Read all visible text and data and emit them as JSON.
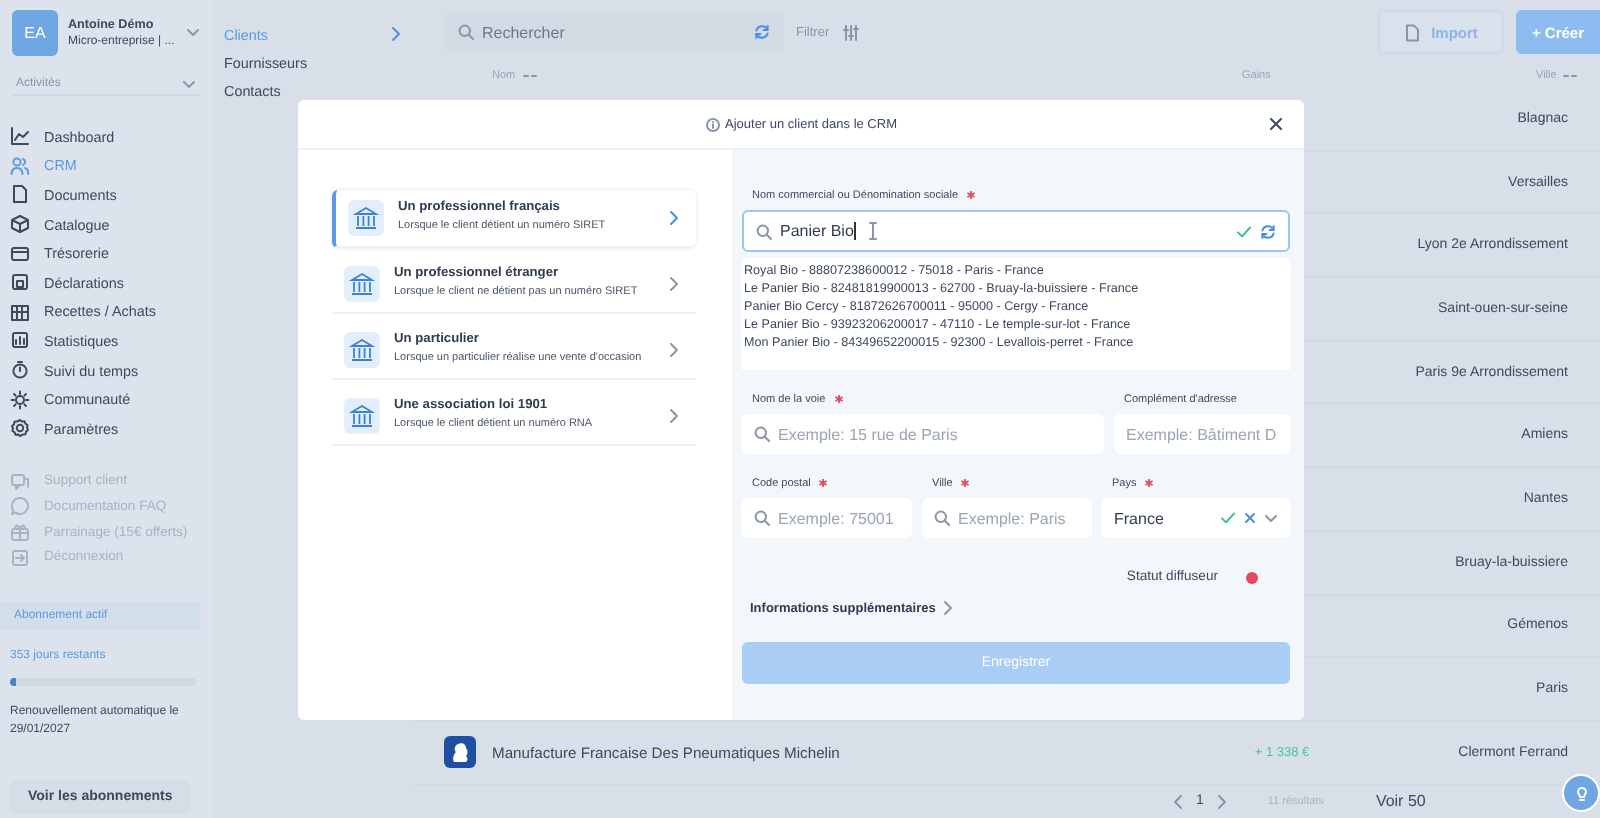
{
  "account": {
    "initials": "EA",
    "name": "Antoine Démo",
    "company": "Micro-entreprise | ..."
  },
  "activity_select": {
    "placeholder": "Activités"
  },
  "nav_items": [
    {
      "label": "Dashboard",
      "selected": false
    },
    {
      "label": "CRM",
      "selected": true
    },
    {
      "label": "Documents",
      "selected": false
    },
    {
      "label": "Catalogue",
      "selected": false
    },
    {
      "label": "Trésorerie",
      "selected": false
    },
    {
      "label": "Déclarations",
      "selected": false
    },
    {
      "label": "Recettes / Achats",
      "selected": false
    },
    {
      "label": "Statistiques",
      "selected": false
    },
    {
      "label": "Suivi du temps",
      "selected": false
    },
    {
      "label": "Communauté",
      "selected": false
    },
    {
      "label": "Paramètres",
      "selected": false
    }
  ],
  "help_items": [
    {
      "label": "Support client"
    },
    {
      "label": "Documentation FAQ"
    },
    {
      "label": "Parrainage (15€ offerts)"
    },
    {
      "label": "Déconnexion"
    }
  ],
  "subscription": {
    "badge": "Abonnement actif",
    "remaining": "353 jours restants",
    "level": 0.03,
    "renewal": "Renouvellement automatique le 29/01/2027",
    "button": "Voir les abonnements"
  },
  "subnav": [
    {
      "label": "Clients",
      "selected": true
    },
    {
      "label": "Fournisseurs",
      "selected": false
    },
    {
      "label": "Contacts",
      "selected": false
    }
  ],
  "toolbar": {
    "search_placeholder": "Rechercher",
    "filter": "Filtrer",
    "import": "Import",
    "create": "+ Créer"
  },
  "table": {
    "columns": [
      "Nom",
      "Gains",
      "Ville"
    ],
    "rows": [
      {
        "city": "Blagnac"
      },
      {
        "city": "Versailles"
      },
      {
        "city": "Lyon 2e Arrondissement"
      },
      {
        "city": "Saint-ouen-sur-seine"
      },
      {
        "city": "Paris 9e Arrondissement"
      },
      {
        "city": "Amiens"
      },
      {
        "city": "Nantes"
      },
      {
        "city": "Bruay-la-buissiere"
      },
      {
        "city": "Gémenos"
      },
      {
        "city": "Paris"
      },
      {
        "name": "Manufacture Francaise Des Pneumatiques Michelin",
        "gains": "+ 1 338 €",
        "city": "Clermont Ferrand"
      }
    ]
  },
  "pagination": {
    "page": "1",
    "results": "11 résultats",
    "page_size": "Voir 50"
  },
  "modal": {
    "title": "Ajouter un client dans le CRM",
    "options": [
      {
        "title": "Un professionnel français",
        "description": "Lorsque le client détient un numéro SIRET",
        "selected": true
      },
      {
        "title": "Un professionnel étranger",
        "description": "Lorsque le client ne détient pas un numéro SIRET",
        "selected": false
      },
      {
        "title": "Un particulier",
        "description": "Lorsque un particulier réalise une vente d'occasion",
        "selected": false
      },
      {
        "title": "Une association loi 1901",
        "description": "Lorsque le client détient un numéro RNA",
        "selected": false
      }
    ],
    "name_field": {
      "label": "Nom commercial ou Dénomination sociale",
      "required": true,
      "value": "Panier Bio"
    },
    "suggestions": [
      "Royal Bio - 88807238600012 - 75018 - Paris - France",
      "Le Panier Bio - 82481819900013 - 62700 - Bruay-la-buissiere - France",
      "Panier Bio Cercy - 81872626700011 - 95000 - Cergy - France",
      "Le Panier Bio - 93923206200017 - 47110 - Le temple-sur-lot - France",
      "Mon Panier Bio - 84349652200015 - 92300 - Levallois-perret - France"
    ],
    "address_rows": [
      [
        {
          "kind": "search",
          "label": "Nom de la voie",
          "required": true,
          "placeholder": "Exemple: 15 rue de Paris"
        },
        {
          "kind": "plain",
          "label": "Complément d'adresse",
          "required": false,
          "placeholder": "Exemple: Bâtiment D"
        }
      ],
      [
        {
          "kind": "search",
          "label": "Code postal",
          "required": true,
          "placeholder": "Exemple: 75001"
        },
        {
          "kind": "search",
          "label": "Ville",
          "required": true,
          "placeholder": "Exemple: Paris"
        },
        {
          "kind": "select",
          "label": "Pays",
          "required": true,
          "value": "France"
        }
      ]
    ],
    "status": {
      "label": "Statut diffuseur",
      "on": false
    },
    "more_info": "Informations supplémentaires",
    "save": {
      "label": "Enregistrer",
      "disabled": true
    }
  }
}
